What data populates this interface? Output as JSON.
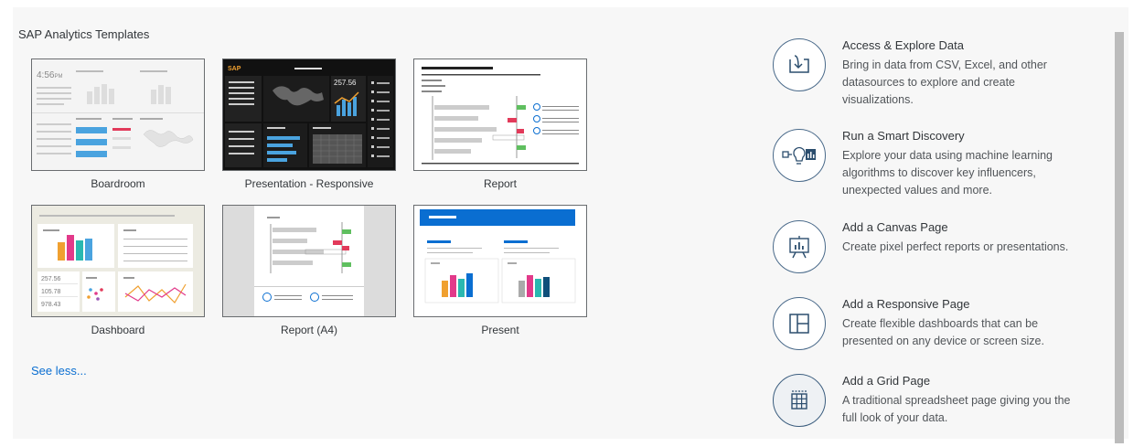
{
  "section_title": "SAP Analytics Templates",
  "templates": [
    {
      "label": "Boardroom"
    },
    {
      "label": "Presentation - Responsive"
    },
    {
      "label": "Report"
    },
    {
      "label": "Dashboard"
    },
    {
      "label": "Report (A4)"
    },
    {
      "label": "Present"
    }
  ],
  "boardroom": {
    "time": "4:56",
    "time_suffix": "PM"
  },
  "presentation": {
    "brand": "SAP",
    "kpi": "257.56"
  },
  "dashboard": {
    "kpis": [
      "257.56",
      "105.78",
      "978.43"
    ]
  },
  "see_less": "See less...",
  "actions": [
    {
      "title": "Access & Explore Data",
      "desc": "Bring in data from CSV, Excel, and other datasources to explore and create visualizations.",
      "icon": "import-data-icon"
    },
    {
      "title": "Run a Smart Discovery",
      "desc": "Explore your data using machine learning algorithms to discover key influencers, unexpected values and more.",
      "icon": "smart-discovery-icon"
    },
    {
      "title": "Add a Canvas Page",
      "desc": "Create pixel perfect reports or presentations.",
      "icon": "canvas-page-icon"
    },
    {
      "title": "Add a Responsive Page",
      "desc": "Create flexible dashboards that can be presented on any device or screen size.",
      "icon": "responsive-page-icon"
    },
    {
      "title": "Add a Grid Page",
      "desc": "A traditional spreadsheet page giving you the full look of your data.",
      "icon": "grid-page-icon"
    }
  ],
  "colors": {
    "accent": "#0a6ed1",
    "green": "#5fbf5f",
    "red": "#e23a5a",
    "teal": "#2ab8b0",
    "orange": "#f0a030",
    "purple": "#9b59b6"
  }
}
